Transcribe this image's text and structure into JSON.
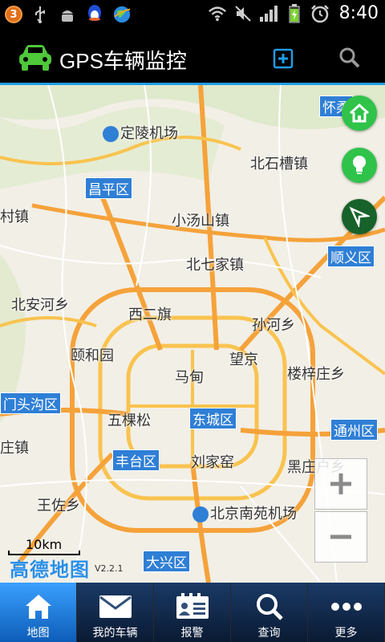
{
  "status_bar": {
    "notification_count": "3",
    "time": "8:40",
    "icons": [
      "usb-icon",
      "android-icon",
      "qq-icon",
      "globe-icon",
      "wifi-icon",
      "mute-icon",
      "signal-icon",
      "battery-charging-icon",
      "alarm-icon"
    ]
  },
  "header": {
    "title": "GPS车辆监控",
    "icons": [
      "car-icon",
      "add-icon",
      "search-icon"
    ],
    "accent": "#1f9be6"
  },
  "map": {
    "labels": {
      "huairou": "怀柔",
      "dingling": "定陵机场",
      "beishicaozhen": "北石槽镇",
      "changping": "昌平区",
      "cunzhen": "村镇",
      "xiaotangshan": "小汤山镇",
      "shunyi": "顺义区",
      "beiqijia": "北七家镇",
      "beianhe": "北安河乡",
      "xierqi": "西二旗",
      "sunhe": "孙河乡",
      "yiheyuan": "颐和园",
      "wangjing": "望京",
      "madian": "马甸",
      "louzizhuang": "楼梓庄乡",
      "mentougou": "门头沟区",
      "wukesong": "五棵松",
      "dongcheng": "东城区",
      "tongzhou": "通州区",
      "zhuang": "庄镇",
      "fengtai": "丰台区",
      "liujiayao": "刘家窑",
      "heizhuanghu": "黑庄户乡",
      "wangzuo": "王佐乡",
      "nanyuan": "北京南苑机场",
      "daxing": "大兴区"
    },
    "scale": "10km",
    "logo_text": "高德地图",
    "version": "V2.2.1",
    "buttons": [
      "home-icon",
      "lightbulb-icon",
      "navigate-icon",
      "zoom-in",
      "zoom-out"
    ]
  },
  "bottom_nav": {
    "items": [
      {
        "label": "地图",
        "icon": "home-icon",
        "active": true
      },
      {
        "label": "我的车辆",
        "icon": "mail-icon",
        "active": false
      },
      {
        "label": "报警",
        "icon": "contact-card-icon",
        "active": false
      },
      {
        "label": "查询",
        "icon": "search-icon",
        "active": false
      },
      {
        "label": "更多",
        "icon": "more-icon",
        "active": false
      }
    ]
  }
}
